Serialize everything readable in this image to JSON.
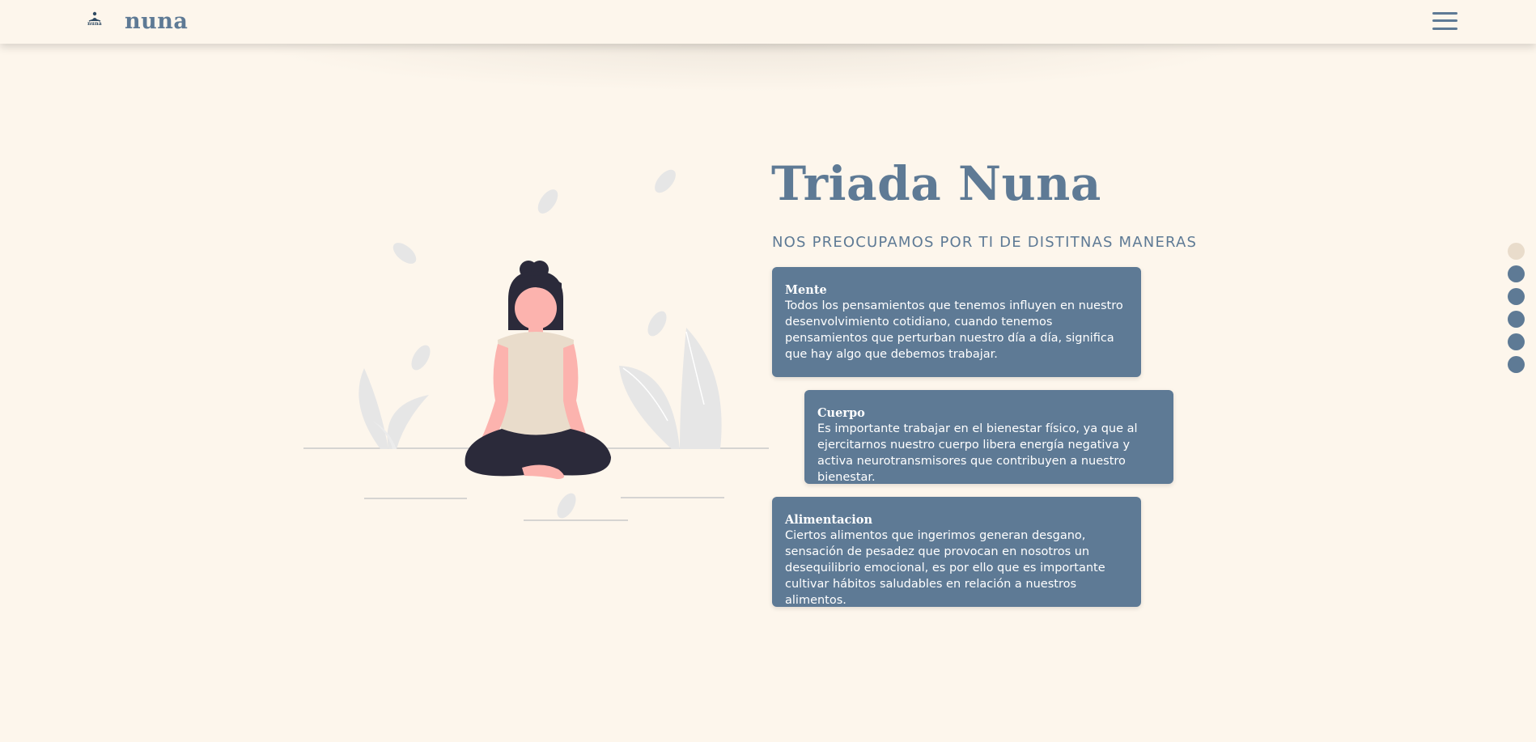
{
  "header": {
    "logo_small_text": "nuna",
    "brand": "nuna",
    "menu_icon": "hamburger-menu-icon"
  },
  "hero": {
    "title": "Triada Nuna",
    "subtitle": "NOS PREOCUPAMOS POR TI DE DISTITNAS MANERAS"
  },
  "cards": [
    {
      "title": "Mente",
      "text": "Todos los pensamientos que tenemos influyen en nuestro desenvolvimiento cotidiano, cuando tenemos pensamientos que perturban nuestro día a día, significa que hay algo que debemos trabajar."
    },
    {
      "title": "Cuerpo",
      "text": "Es importante trabajar en el bienestar físico, ya que al ejercitarnos nuestro cuerpo libera energía negativa y activa neurotransmisores que contribuyen a nuestro bienestar."
    },
    {
      "title": "Alimentacion",
      "text": "Ciertos alimentos que ingerimos generan desgano, sensación de pesadez que provocan en nosotros un desequilibrio emocional, es por ello que es importante cultivar hábitos saludables en relación a nuestros alimentos."
    }
  ],
  "pagination": {
    "count": 6,
    "active_index": 0
  },
  "colors": {
    "background": "#fdf6ec",
    "primary": "#5e7a95",
    "dot_active": "#e9dccb",
    "skin": "#fcb3ae",
    "shirt": "#e9dccb",
    "dark": "#2b2a3a",
    "leaf": "#e6e6e6"
  }
}
